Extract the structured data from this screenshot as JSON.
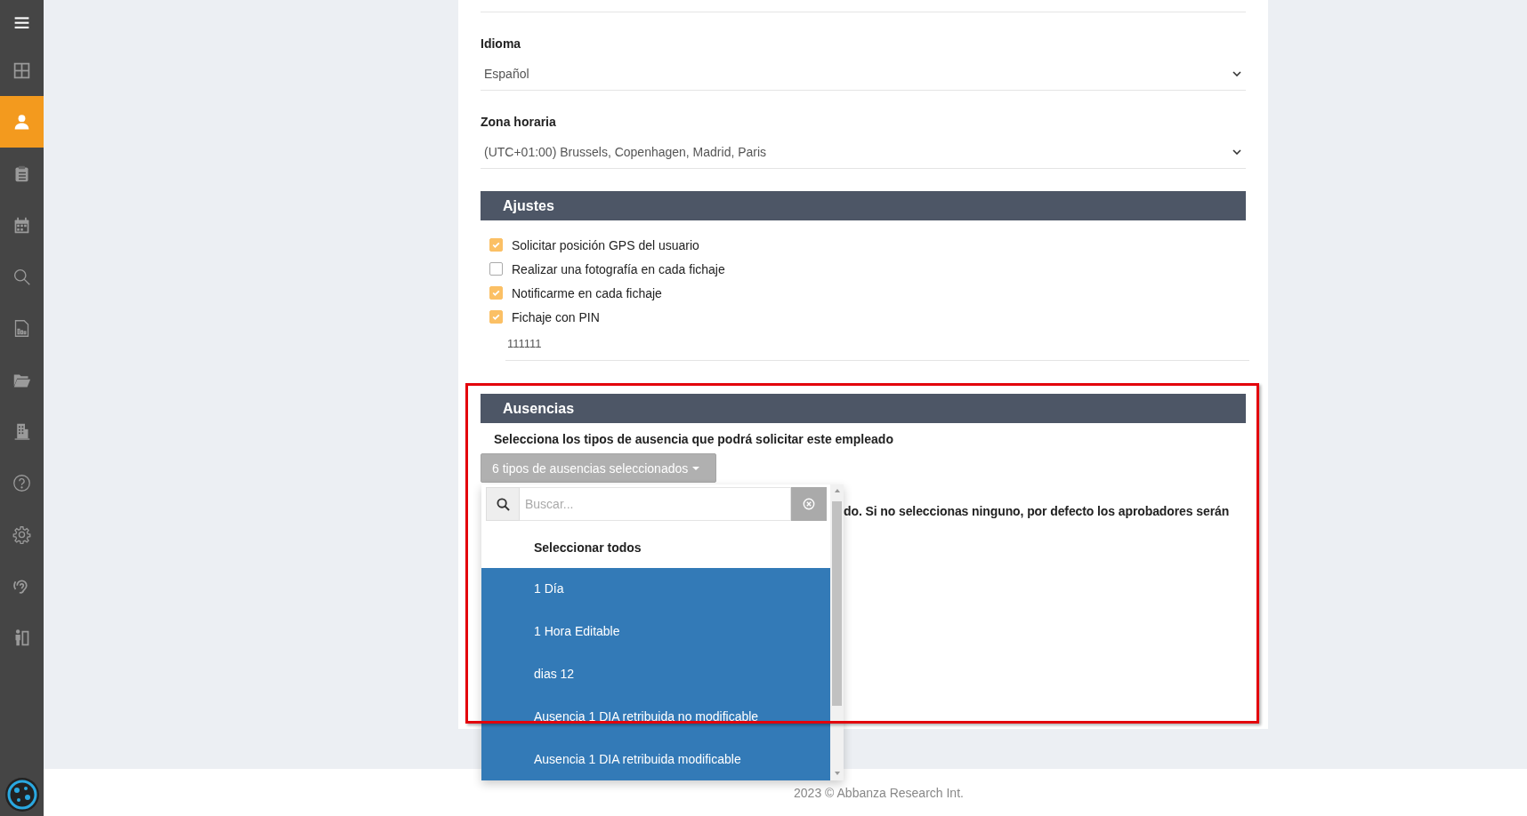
{
  "sidebar": {
    "items": [
      {
        "selected": false
      },
      {
        "selected": false
      },
      {
        "selected": true
      },
      {
        "selected": false
      },
      {
        "selected": false
      },
      {
        "selected": false
      },
      {
        "selected": false
      },
      {
        "selected": false
      },
      {
        "selected": false
      },
      {
        "selected": false
      },
      {
        "selected": false
      },
      {
        "selected": false
      },
      {
        "selected": false
      }
    ]
  },
  "fields": [
    {
      "label": "Idioma",
      "value": "Español"
    },
    {
      "label": "Zona horaria",
      "value": "(UTC+01:00) Brussels, Copenhagen, Madrid, Paris"
    }
  ],
  "ajustes": {
    "title": "Ajustes",
    "options": [
      {
        "label": "Solicitar posición GPS del usuario",
        "checked": true
      },
      {
        "label": "Realizar una fotografía en cada fichaje",
        "checked": false
      },
      {
        "label": "Notificarme en cada fichaje",
        "checked": true
      },
      {
        "label": "Fichaje con PIN",
        "checked": true
      }
    ],
    "pin": "111111"
  },
  "ausencias": {
    "title": "Ausencias",
    "description": "Selecciona los tipos de ausencia que podrá solicitar este empleado",
    "dropdown_label": "6 tipos de ausencias seleccionados",
    "partial_text": "do. Si no seleccionas ninguno, por defecto los aprobadores serán",
    "menu": {
      "search_placeholder": "Buscar...",
      "select_all": "Seleccionar todos",
      "options": [
        {
          "label": "1 Día",
          "selected": true
        },
        {
          "label": "1 Hora Editable",
          "selected": true
        },
        {
          "label": "dias 12",
          "selected": true
        },
        {
          "label": "Ausencia 1 DIA retribuida no modificable",
          "selected": true
        },
        {
          "label": "Ausencia 1 DIA retribuida modificable",
          "selected": true
        }
      ]
    }
  },
  "footer": "2023 © Abbanza Research Int."
}
